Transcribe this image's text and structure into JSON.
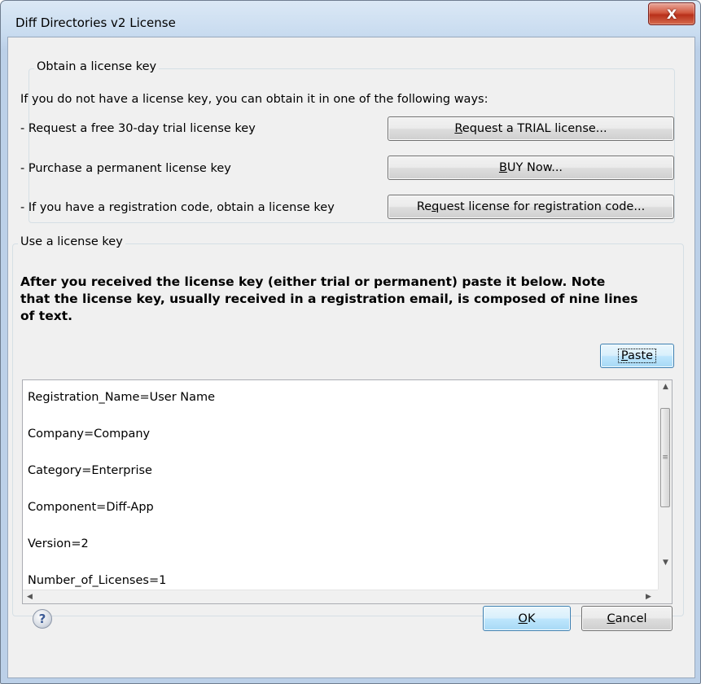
{
  "window": {
    "title": "Diff Directories v2 License",
    "close_glyph": "X"
  },
  "obtain_group": {
    "legend": "Obtain a license key",
    "intro": "If you do not have a license key, you can obtain it in one of the following ways:",
    "rows": [
      {
        "label": "- Request a free 30-day trial license key",
        "button_prefix": "",
        "button_mnemonic": "R",
        "button_rest": "equest a TRIAL license..."
      },
      {
        "label": "- Purchase a permanent license key",
        "button_prefix": "",
        "button_mnemonic": "B",
        "button_rest": "UY Now..."
      },
      {
        "label": "- If you have a registration code, obtain a license key",
        "button_prefix": "Re",
        "button_mnemonic": "q",
        "button_rest": "uest license for registration code..."
      }
    ]
  },
  "use_group": {
    "legend": "Use a license key",
    "instructions_line1": "After you received the license key (either trial or permanent) paste it below. Note",
    "instructions_line2": "that the license key, usually received in a registration email, is composed of nine lines",
    "instructions_line3": "of text.",
    "paste_mnemonic": "P",
    "paste_rest": "aste",
    "license_lines": [
      "Registration_Name=User Name",
      "Company=Company",
      "Category=Enterprise",
      "Component=Diff-App",
      "Version=2",
      "Number_of_Licenses=1"
    ]
  },
  "footer": {
    "help_glyph": "?",
    "ok_mnemonic": "O",
    "ok_rest": "K",
    "cancel_mnemonic": "C",
    "cancel_rest": "ancel"
  },
  "scroll_glyphs": {
    "up": "▲",
    "down": "▼",
    "left": "◀",
    "right": "▶",
    "grip": "≡"
  },
  "colors": {
    "close_button": "#c7442b",
    "focused_button": "#3c7fb1",
    "dialog_bg": "#f0f0f0"
  }
}
